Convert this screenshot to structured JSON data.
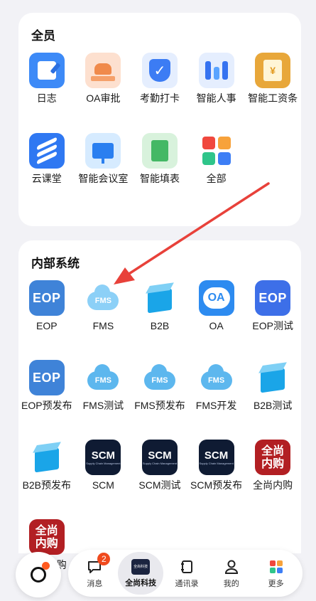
{
  "sections": {
    "all_staff": {
      "title": "全员",
      "apps": [
        {
          "label": "日志",
          "icon": "diary-icon"
        },
        {
          "label": "OA审批",
          "icon": "stamp-icon"
        },
        {
          "label": "考勤打卡",
          "icon": "check-shield-icon"
        },
        {
          "label": "智能人事",
          "icon": "hr-icon"
        },
        {
          "label": "智能工资条",
          "icon": "salary-slip-icon",
          "glyph": "¥"
        },
        {
          "label": "云课堂",
          "icon": "cloud-class-icon"
        },
        {
          "label": "智能会议室",
          "icon": "meeting-board-icon"
        },
        {
          "label": "智能填表",
          "icon": "form-book-icon"
        },
        {
          "label": "全部",
          "icon": "all-apps-icon"
        }
      ]
    },
    "internal": {
      "title": "内部系统",
      "apps": [
        {
          "label": "EOP",
          "icon": "eop-icon",
          "glyph": "EOP"
        },
        {
          "label": "FMS",
          "icon": "fms-cloud-icon",
          "glyph": "FMS"
        },
        {
          "label": "B2B",
          "icon": "b2b-cube-icon"
        },
        {
          "label": "OA",
          "icon": "oa-bubble-icon",
          "glyph": "OA"
        },
        {
          "label": "EOP测试",
          "icon": "eop-icon",
          "glyph": "EOP"
        },
        {
          "label": "EOP预发布",
          "icon": "eop-icon",
          "glyph": "EOP"
        },
        {
          "label": "FMS测试",
          "icon": "fms-cloud-icon",
          "glyph": "FMS"
        },
        {
          "label": "FMS预发布",
          "icon": "fms-cloud-icon",
          "glyph": "FMS"
        },
        {
          "label": "FMS开发",
          "icon": "fms-cloud-icon",
          "glyph": "FMS"
        },
        {
          "label": "B2B测试",
          "icon": "b2b-cube-icon"
        },
        {
          "label": "B2B预发布",
          "icon": "b2b-cube-icon"
        },
        {
          "label": "SCM",
          "icon": "scm-icon",
          "glyph": "SCM",
          "sub": "Supply Chain Management"
        },
        {
          "label": "SCM测试",
          "icon": "scm-icon",
          "glyph": "SCM",
          "sub": "Supply Chain Management"
        },
        {
          "label": "SCM预发布",
          "icon": "scm-icon",
          "glyph": "SCM",
          "sub": "Supply Chain Management"
        },
        {
          "label": "全尚内购",
          "icon": "quanshang-icon",
          "glyph1": "全尚",
          "glyph2": "内购"
        },
        {
          "label": "全尚内购",
          "icon": "quanshang-icon",
          "glyph1": "全尚",
          "glyph2": "内购"
        }
      ]
    }
  },
  "tabbar": {
    "messages": {
      "label": "消息",
      "badge": "2"
    },
    "home": {
      "label": "全尚科技",
      "logo_text": "全尚科技"
    },
    "contacts": {
      "label": "通讯录"
    },
    "me": {
      "label": "我的"
    },
    "more": {
      "label": "更多"
    }
  },
  "colors": {
    "arrow": "#e8413a",
    "accent": "#3d7ef5",
    "badge": "#f04a1e"
  }
}
